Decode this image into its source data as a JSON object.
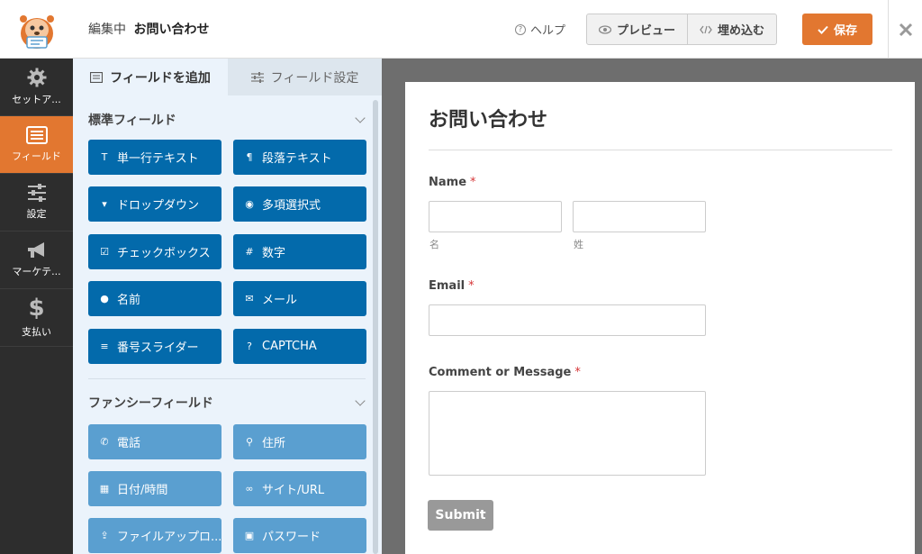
{
  "header": {
    "editing_label": "編集中",
    "form_name": "お問い合わせ",
    "help_label": "ヘルプ",
    "preview_label": "プレビュー",
    "embed_label": "埋め込む",
    "save_label": "保存"
  },
  "leftnav": {
    "items": [
      {
        "label": "セットア...",
        "icon": "gear-icon"
      },
      {
        "label": "フィールド",
        "icon": "fields-icon"
      },
      {
        "label": "設定",
        "icon": "sliders-icon"
      },
      {
        "label": "マーケテ...",
        "icon": "megaphone-icon"
      },
      {
        "label": "支払い",
        "icon": "dollar-icon"
      }
    ],
    "active_index": 1
  },
  "panel": {
    "tabs": [
      {
        "label": "フィールドを追加"
      },
      {
        "label": "フィールド設定"
      }
    ],
    "standard_heading": "標準フィールド",
    "standard_fields": [
      {
        "label": "単一行テキスト",
        "icon": "text-icon"
      },
      {
        "label": "段落テキスト",
        "icon": "paragraph-icon"
      },
      {
        "label": "ドロップダウン",
        "icon": "dropdown-icon"
      },
      {
        "label": "多項選択式",
        "icon": "radio-icon"
      },
      {
        "label": "チェックボックス",
        "icon": "checkbox-icon"
      },
      {
        "label": "数字",
        "icon": "hash-icon"
      },
      {
        "label": "名前",
        "icon": "user-icon"
      },
      {
        "label": "メール",
        "icon": "envelope-icon"
      },
      {
        "label": "番号スライダー",
        "icon": "slider-icon"
      },
      {
        "label": "CAPTCHA",
        "icon": "question-icon"
      }
    ],
    "fancy_heading": "ファンシーフィールド",
    "fancy_fields": [
      {
        "label": "電話",
        "icon": "phone-icon"
      },
      {
        "label": "住所",
        "icon": "map-pin-icon"
      },
      {
        "label": "日付/時間",
        "icon": "calendar-icon"
      },
      {
        "label": "サイト/URL",
        "icon": "link-icon"
      },
      {
        "label": "ファイルアップロ...",
        "icon": "upload-icon"
      },
      {
        "label": "パスワード",
        "icon": "lock-icon"
      }
    ]
  },
  "form": {
    "title": "お問い合わせ",
    "name_label": "Name",
    "name_first_sublabel": "名",
    "name_last_sublabel": "姓",
    "email_label": "Email",
    "message_label": "Comment or Message",
    "required_mark": "*",
    "submit_label": "Submit"
  },
  "colors": {
    "accent": "#e27730",
    "standard_button": "#036aab",
    "fancy_button": "#5a9fd0",
    "nav_bg": "#2d2d2d",
    "panel_bg": "#ebf3fb",
    "preview_bg": "#6e6e6e"
  }
}
